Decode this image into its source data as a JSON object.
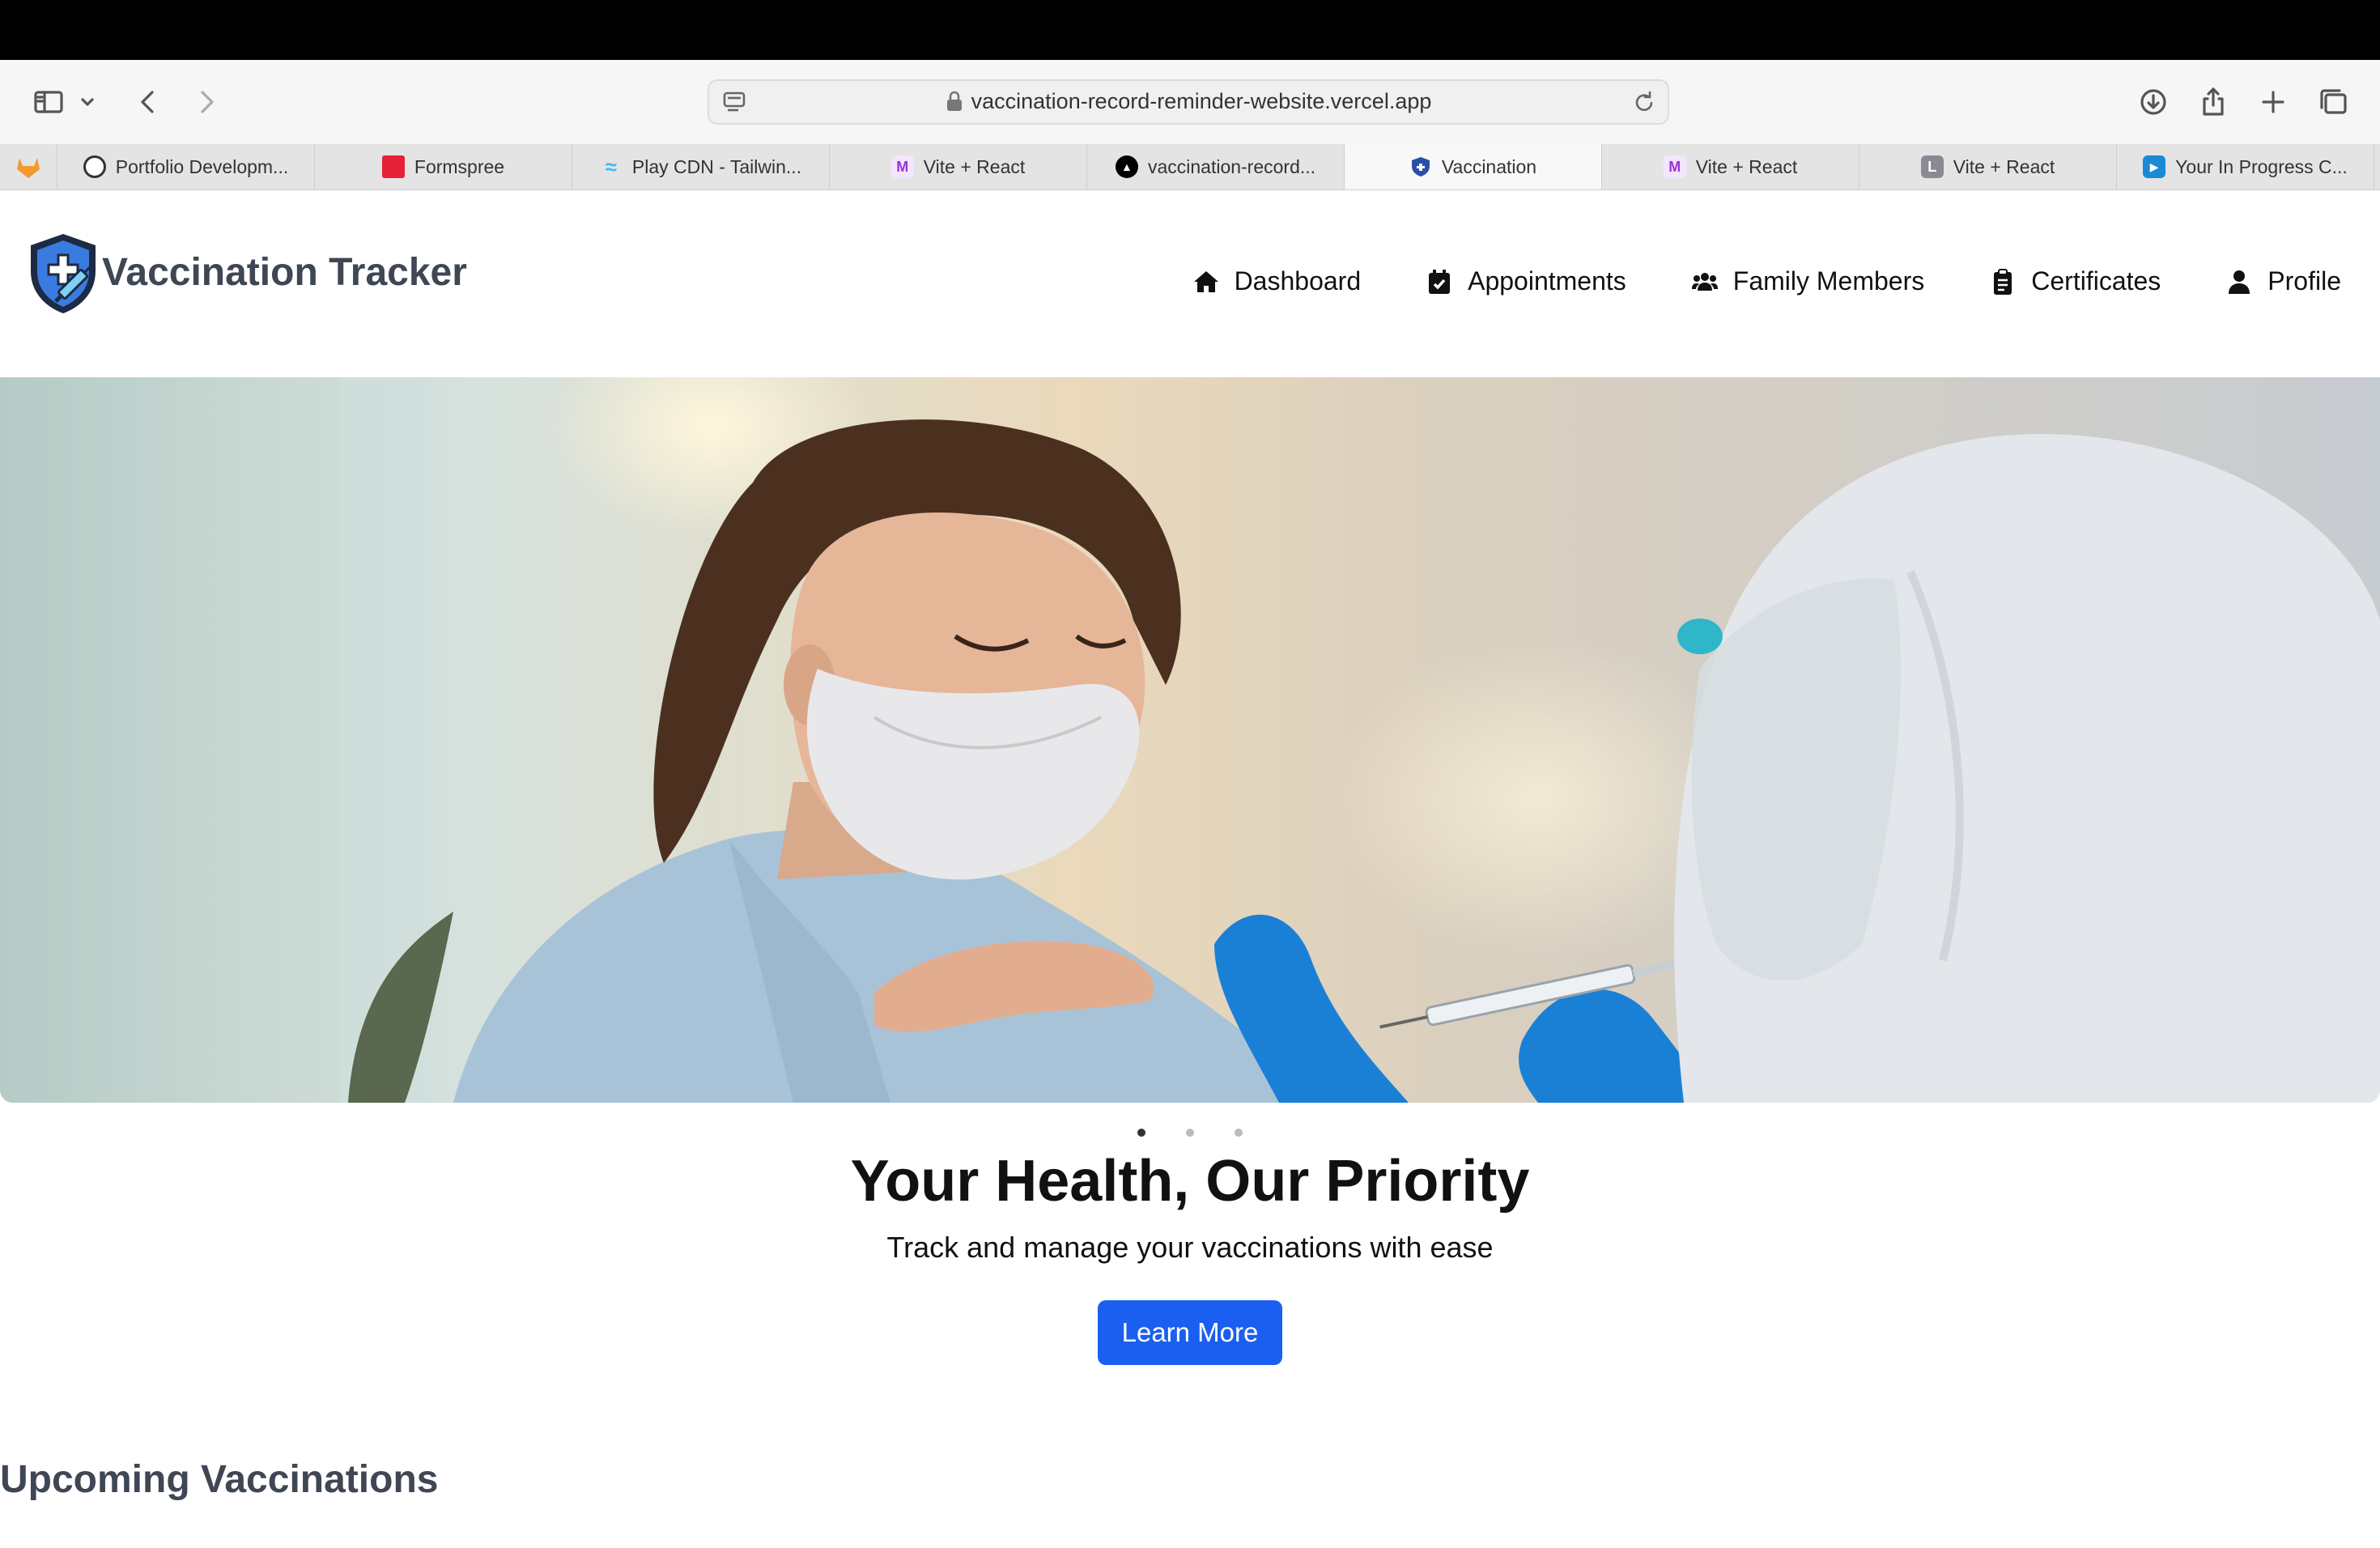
{
  "browser": {
    "url": "vaccination-record-reminder-website.vercel.app",
    "tabs": [
      {
        "label": "Portfolio Developm...",
        "icon": "openai-icon"
      },
      {
        "label": "Formspree",
        "icon": "formspree-icon"
      },
      {
        "label": "Play CDN - Tailwin...",
        "icon": "tailwind-icon"
      },
      {
        "label": "Vite + React",
        "icon": "m-icon"
      },
      {
        "label": "vaccination-record...",
        "icon": "vercel-icon"
      },
      {
        "label": "Vaccination",
        "icon": "shield-icon",
        "active": true
      },
      {
        "label": "Vite + React",
        "icon": "m-icon"
      },
      {
        "label": "Vite + React",
        "icon": "l-icon"
      },
      {
        "label": "Your In Progress C...",
        "icon": "play-icon"
      }
    ]
  },
  "site": {
    "brand": "Vaccination Tracker",
    "nav": {
      "dashboard": "Dashboard",
      "appointments": "Appointments",
      "family": "Family Members",
      "certificates": "Certificates",
      "profile": "Profile"
    },
    "hero": {
      "title": "Your Health, Our Priority",
      "subtitle": "Track and manage your vaccinations with ease",
      "cta": "Learn More",
      "slides": 3,
      "active_slide": 1
    },
    "section_title": "Upcoming Vaccinations"
  },
  "colors": {
    "accent": "#1b5ff0",
    "brand_text": "#3f4654"
  }
}
